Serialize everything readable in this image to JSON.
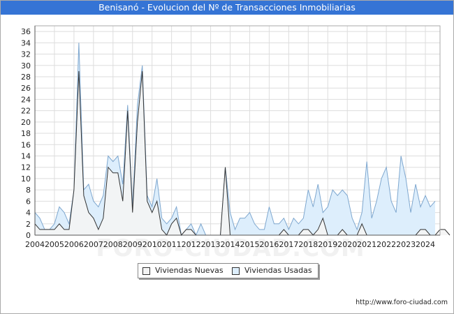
{
  "chart_data": {
    "type": "area",
    "title": "Benisanó - Evolucion del Nº de Transacciones Inmobiliarias",
    "xlabel": "",
    "ylabel": "",
    "ylim": [
      0,
      37
    ],
    "y_ticks": [
      0,
      2,
      4,
      6,
      8,
      10,
      12,
      14,
      16,
      18,
      20,
      22,
      24,
      26,
      28,
      30,
      32,
      34,
      36
    ],
    "x_range": [
      2004,
      2024.75
    ],
    "x_tick_labels": [
      "2004",
      "2005",
      "2006",
      "2007",
      "2008",
      "2009",
      "2010",
      "2011",
      "2012",
      "2013",
      "2014",
      "2015",
      "2016",
      "2017",
      "2018",
      "2019",
      "2020",
      "2021",
      "2022",
      "2023",
      "2024"
    ],
    "grid": true,
    "legend_position": "bottom-center",
    "x_unit": "quarter",
    "x_start": 2004,
    "series": [
      {
        "name": "Viviendas Nuevas",
        "fill": "#f4f4f4",
        "stroke": "#333333",
        "values": [
          2,
          1,
          1,
          1,
          1,
          2,
          1,
          1,
          8,
          29,
          7,
          4,
          3,
          1,
          3,
          12,
          11,
          11,
          6,
          22,
          4,
          20,
          29,
          6,
          4,
          6,
          1,
          0,
          2,
          3,
          0,
          1,
          1,
          0,
          0,
          0,
          0,
          0,
          0,
          12,
          0,
          0,
          0,
          0,
          0,
          0,
          0,
          0,
          0,
          0,
          0,
          1,
          0,
          0,
          0,
          1,
          1,
          0,
          1,
          3,
          0,
          0,
          0,
          1,
          0,
          0,
          0,
          2,
          0,
          0,
          0,
          0,
          0,
          0,
          0,
          0,
          0,
          0,
          0,
          1,
          1,
          0,
          0,
          1,
          1,
          0
        ]
      },
      {
        "name": "Viviendas Usadas",
        "fill": "#ddeefc",
        "stroke": "#7ea7cf",
        "values": [
          4,
          3,
          1,
          1,
          2,
          5,
          4,
          2,
          8,
          34,
          8,
          9,
          6,
          5,
          7,
          14,
          13,
          14,
          9,
          23,
          5,
          23,
          30,
          7,
          5,
          10,
          3,
          2,
          3,
          5,
          0,
          1,
          2,
          0,
          2,
          0,
          0,
          0,
          0,
          12,
          4,
          1,
          3,
          3,
          4,
          2,
          1,
          1,
          5,
          2,
          2,
          3,
          1,
          3,
          2,
          3,
          8,
          5,
          9,
          4,
          5,
          8,
          7,
          8,
          7,
          3,
          1,
          4,
          13,
          3,
          6,
          10,
          12,
          6,
          4,
          14,
          10,
          4,
          9,
          5,
          7,
          5,
          6
        ]
      }
    ]
  },
  "legend": {
    "items": [
      {
        "label": "Viviendas Nuevas"
      },
      {
        "label": "Viviendas Usadas"
      }
    ]
  },
  "watermark_text": "FORO-CIUDAD.COM",
  "source_text": "http://www.foro-ciudad.com"
}
